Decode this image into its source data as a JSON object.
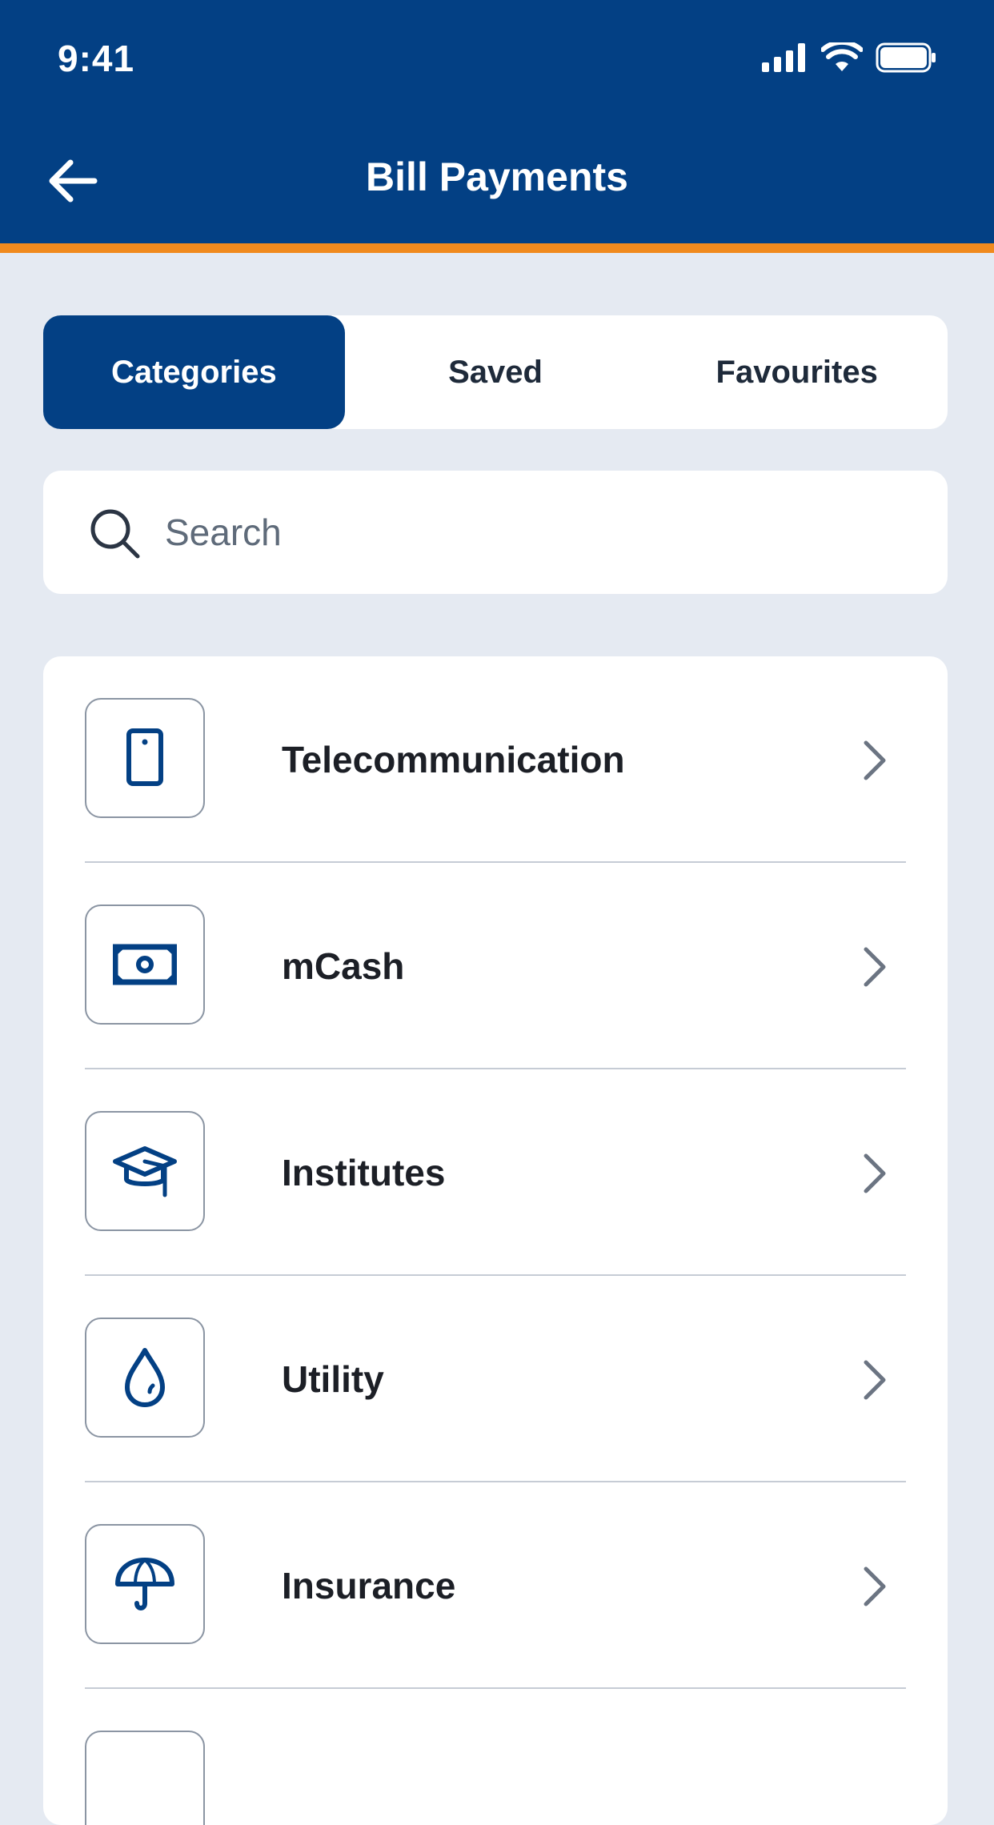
{
  "status_bar": {
    "time": "9:41"
  },
  "header": {
    "title": "Bill Payments"
  },
  "tabs": [
    {
      "label": "Categories",
      "active": true
    },
    {
      "label": "Saved",
      "active": false
    },
    {
      "label": "Favourites",
      "active": false
    }
  ],
  "search": {
    "placeholder": "Search",
    "value": ""
  },
  "categories": [
    {
      "label": "Telecommunication",
      "icon": "phone-icon"
    },
    {
      "label": "mCash",
      "icon": "cash-icon"
    },
    {
      "label": "Institutes",
      "icon": "graduation-cap-icon"
    },
    {
      "label": "Utility",
      "icon": "water-drop-icon"
    },
    {
      "label": "Insurance",
      "icon": "umbrella-icon"
    }
  ],
  "colors": {
    "header": "#034084",
    "accent": "#F08A1E",
    "background": "#E5EAF2",
    "icon": "#034084"
  }
}
